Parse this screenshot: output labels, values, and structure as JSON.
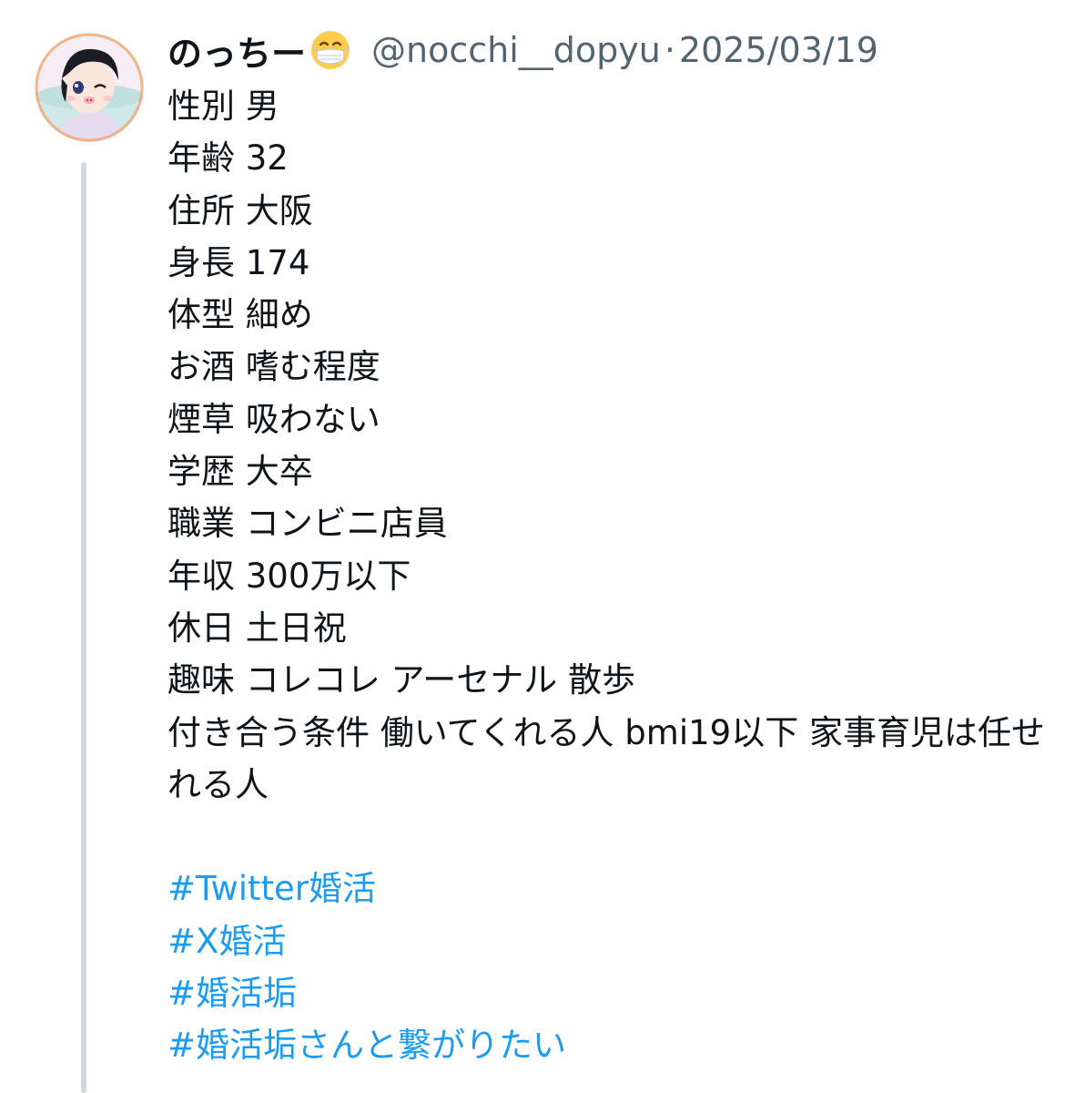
{
  "user": {
    "display_name": "のっちー",
    "display_name_emoji": "face-with-medical-mask",
    "handle": "@nocchi__dopyu",
    "separator": "·",
    "date": "2025/03/19"
  },
  "body": {
    "lines": [
      "性別 男",
      "年齢 32",
      "住所 大阪",
      "身長 174",
      "体型 細め",
      "お酒 嗜む程度",
      "煙草 吸わない",
      "学歴 大卒",
      "職業 コンビニ店員",
      "年収 300万以下",
      "休日 土日祝",
      "趣味 コレコレ アーセナル 散歩",
      "付き合う条件 働いてくれる人 bmi19以下 家事育児は任せれる人"
    ],
    "hashtags": [
      "#Twitter婚活",
      "#X婚活",
      "#婚活垢",
      "#婚活垢さんと繋がりたい"
    ]
  },
  "colors": {
    "text": "#0f1419",
    "secondary": "#536471",
    "link": "#1d9bf0",
    "thread_line": "#cfd9de"
  }
}
